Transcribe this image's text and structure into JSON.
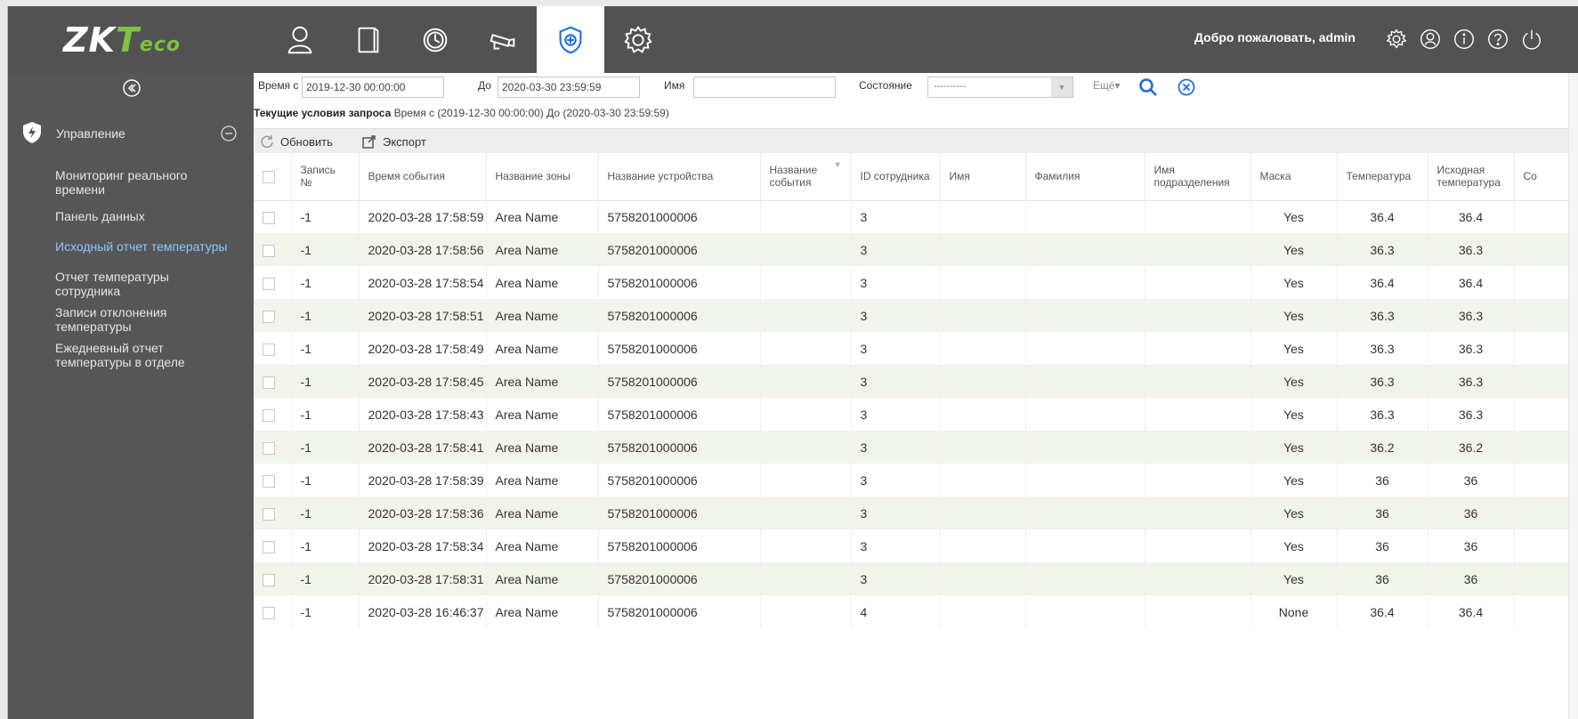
{
  "brand": {
    "logo_zk": "ZK",
    "logo_t": "T",
    "logo_eco": "eco"
  },
  "header": {
    "modules": [
      "person-icon",
      "door-icon",
      "clock-icon",
      "camera-icon",
      "shield-plus-icon",
      "gear-icon"
    ],
    "active_module": "shield-plus-icon",
    "welcome": "Добро пожаловать, admin"
  },
  "sidebar": {
    "section_label": "Управление",
    "items": [
      {
        "label": "Мониторинг реального времени",
        "active": false
      },
      {
        "label": "Панель данных",
        "active": false
      },
      {
        "label": "Исходный отчет температуры",
        "active": true
      },
      {
        "label": "Отчет температуры сотрудника",
        "active": false
      },
      {
        "label": "Записи отклонения температуры",
        "active": false
      },
      {
        "label": "Ежедневный отчет температуры в отделе",
        "active": false
      }
    ]
  },
  "filter": {
    "time_from_label": "Время с",
    "time_from_value": "2019-12-30 00:00:00",
    "time_to_label": "До",
    "time_to_value": "2020-03-30 23:59:59",
    "name_label": "Имя",
    "name_value": "",
    "state_label": "Состояние",
    "state_value": "----------",
    "more_label": "Ещё▾"
  },
  "condition": {
    "bold": "Текущие условия запроса",
    "text": "Время с (2019-12-30 00:00:00)  До (2020-03-30 23:59:59)"
  },
  "toolbar": {
    "refresh": "Обновить",
    "export": "Экспорт"
  },
  "table": {
    "headers": [
      "Запись №",
      "Время события",
      "Название зоны",
      "Название устройства",
      "Название события",
      "ID сотрудника",
      "Имя",
      "Фамилия",
      "Имя подразделения",
      "Маска",
      "Температура",
      "Исходная температура",
      "Со"
    ],
    "rows": [
      [
        "-1",
        "2020-03-28 17:58:59",
        "Area Name",
        "5758201000006",
        "3",
        "Yes",
        "36.4",
        "36.4"
      ],
      [
        "-1",
        "2020-03-28 17:58:56",
        "Area Name",
        "5758201000006",
        "3",
        "Yes",
        "36.3",
        "36.3"
      ],
      [
        "-1",
        "2020-03-28 17:58:54",
        "Area Name",
        "5758201000006",
        "3",
        "Yes",
        "36.4",
        "36.4"
      ],
      [
        "-1",
        "2020-03-28 17:58:51",
        "Area Name",
        "5758201000006",
        "3",
        "Yes",
        "36.3",
        "36.3"
      ],
      [
        "-1",
        "2020-03-28 17:58:49",
        "Area Name",
        "5758201000006",
        "3",
        "Yes",
        "36.3",
        "36.3"
      ],
      [
        "-1",
        "2020-03-28 17:58:45",
        "Area Name",
        "5758201000006",
        "3",
        "Yes",
        "36.3",
        "36.3"
      ],
      [
        "-1",
        "2020-03-28 17:58:43",
        "Area Name",
        "5758201000006",
        "3",
        "Yes",
        "36.3",
        "36.3"
      ],
      [
        "-1",
        "2020-03-28 17:58:41",
        "Area Name",
        "5758201000006",
        "3",
        "Yes",
        "36.2",
        "36.2"
      ],
      [
        "-1",
        "2020-03-28 17:58:39",
        "Area Name",
        "5758201000006",
        "3",
        "Yes",
        "36",
        "36"
      ],
      [
        "-1",
        "2020-03-28 17:58:36",
        "Area Name",
        "5758201000006",
        "3",
        "Yes",
        "36",
        "36"
      ],
      [
        "-1",
        "2020-03-28 17:58:34",
        "Area Name",
        "5758201000006",
        "3",
        "Yes",
        "36",
        "36"
      ],
      [
        "-1",
        "2020-03-28 17:58:31",
        "Area Name",
        "5758201000006",
        "3",
        "Yes",
        "36",
        "36"
      ],
      [
        "-1",
        "2020-03-28 16:46:37",
        "Area Name",
        "5758201000006",
        "4",
        "None",
        "36.4",
        "36.4"
      ]
    ]
  },
  "colors": {
    "header_bg": "#525252",
    "sidebar_bg": "#565656",
    "active_link": "#8fc8ff",
    "accent_blue": "#1e6fd9",
    "row_alt": "#f1f4ea"
  }
}
